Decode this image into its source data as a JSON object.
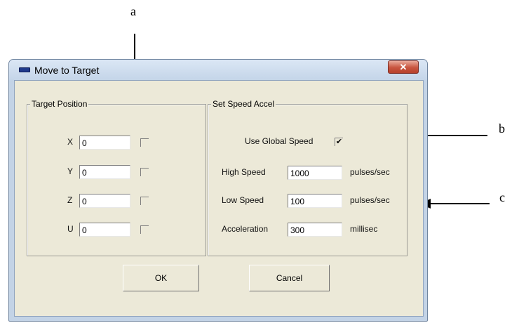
{
  "callouts": {
    "a": "a",
    "b": "b",
    "c": "c"
  },
  "window": {
    "title": "Move to Target",
    "close_glyph": "✕",
    "title_icon": "window-app-icon"
  },
  "target_position": {
    "legend": "Target Position",
    "axes": [
      {
        "label": "X",
        "value": "0",
        "checked": false
      },
      {
        "label": "Y",
        "value": "0",
        "checked": false
      },
      {
        "label": "Z",
        "value": "0",
        "checked": false
      },
      {
        "label": "U",
        "value": "0",
        "checked": false
      }
    ]
  },
  "speed_accel": {
    "legend": "Set Speed Accel",
    "use_global_label": "Use Global Speed",
    "use_global_checked": true,
    "check_glyph": "✔",
    "high_speed": {
      "label": "High Speed",
      "value": "1000",
      "unit": "pulses/sec"
    },
    "low_speed": {
      "label": "Low Speed",
      "value": "100",
      "unit": "pulses/sec"
    },
    "acceleration": {
      "label": "Acceleration",
      "value": "300",
      "unit": "millisec"
    }
  },
  "buttons": {
    "ok": "OK",
    "cancel": "Cancel"
  }
}
